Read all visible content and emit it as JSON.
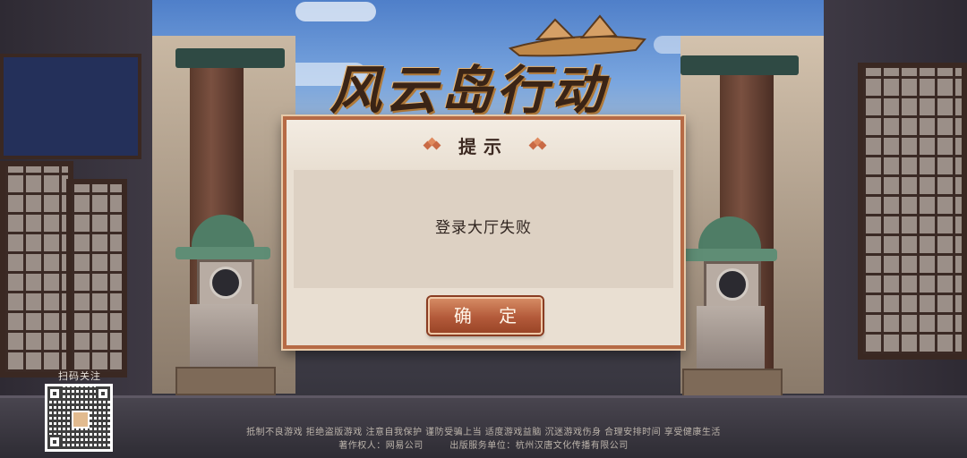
{
  "game": {
    "logo_text": "风云岛行动"
  },
  "dialog": {
    "title": "提示",
    "message": "登录大厅失败",
    "confirm_label": "确 定"
  },
  "qr": {
    "label": "扫码关注"
  },
  "footer": {
    "line1": "抵制不良游戏 拒绝盗版游戏 注意自我保护 谨防受骗上当 适度游戏益脑 沉迷游戏伤身 合理安排时间 享受健康生活",
    "line2": "著作权人：网易公司        出版服务单位：杭州汉唐文化传播有限公司"
  },
  "colors": {
    "dialog_border": "#b66a45",
    "button": "#b35a3a",
    "dialog_bg": "#e9dfd2"
  }
}
